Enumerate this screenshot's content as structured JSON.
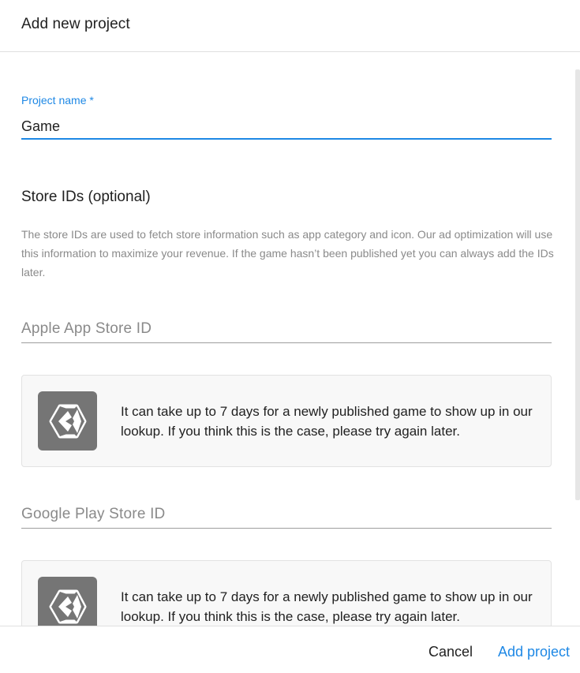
{
  "dialog": {
    "title": "Add new project"
  },
  "project_name": {
    "label": "Project name *",
    "value": "Game"
  },
  "store_ids": {
    "title": "Store IDs (optional)",
    "description": "The store IDs are used to fetch store information such as app category and icon. Our ad optimization will use this information to maximize your revenue. If the game hasn’t been published yet you can always add the IDs later.",
    "apple": {
      "placeholder": "Apple App Store ID",
      "value": "",
      "info_icon": "unity-logo-icon",
      "info_text": "It can take up to 7 days for a newly published game to show up in our lookup. If you think this is the case, please try again later."
    },
    "google": {
      "placeholder": "Google Play Store ID",
      "value": "",
      "info_icon": "unity-logo-icon",
      "info_text": "It can take up to 7 days for a newly published game to show up in our lookup. If you think this is the case, please try again later."
    }
  },
  "footer": {
    "cancel_label": "Cancel",
    "add_label": "Add project"
  },
  "colors": {
    "accent": "#1e88e5",
    "logo_bg": "#757575",
    "info_bg": "#f8f8f8"
  }
}
